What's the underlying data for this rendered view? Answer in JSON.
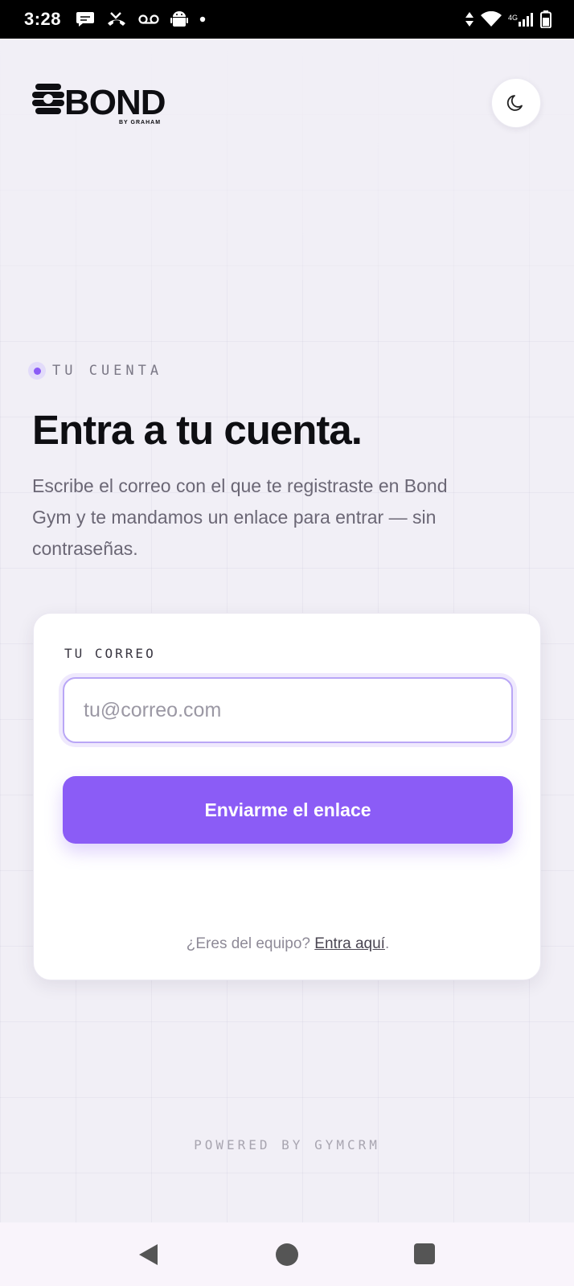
{
  "status_bar": {
    "time": "3:28",
    "network": "4G"
  },
  "header": {
    "logo_text": "BOND",
    "logo_subtext": "BY GRAHAM",
    "theme_toggle_icon": "moon-icon"
  },
  "intro": {
    "eyebrow": "TU CUENTA",
    "title": "Entra a tu cuenta.",
    "lead": "Escribe el correo con el que te registraste en Bond Gym y te mandamos un enlace para entrar — sin contraseñas."
  },
  "login_card": {
    "email_label": "TU CORREO",
    "email_placeholder": "tu@correo.com",
    "email_value": "",
    "submit_label": "Enviarme el enlace",
    "team_prompt": "¿Eres del equipo?",
    "team_link": "Entra aquí",
    "team_suffix": "."
  },
  "footer": {
    "powered_by": "POWERED BY GYMCRM"
  },
  "colors": {
    "accent": "#8b5cf6",
    "background": "#f1eff6",
    "card": "#ffffff"
  }
}
